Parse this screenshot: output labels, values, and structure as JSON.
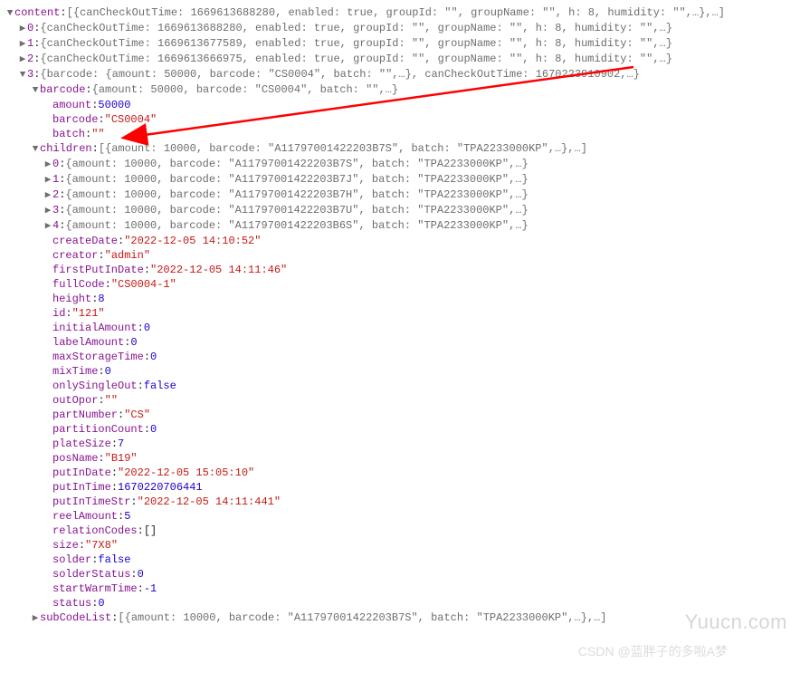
{
  "glyphs": {
    "down": "▼",
    "right": "▶"
  },
  "root": {
    "key": "content",
    "preview": "[{canCheckOutTime: 1669613688280, enabled: true, groupId: \"\", groupName: \"\", h: 8, humidity: \"\",…},…]"
  },
  "items": [
    {
      "idx": "0",
      "preview": "{canCheckOutTime: 1669613688280, enabled: true, groupId: \"\", groupName: \"\", h: 8, humidity: \"\",…}"
    },
    {
      "idx": "1",
      "preview": "{canCheckOutTime: 1669613677589, enabled: true, groupId: \"\", groupName: \"\", h: 8, humidity: \"\",…}"
    },
    {
      "idx": "2",
      "preview": "{canCheckOutTime: 1669613666975, enabled: true, groupId: \"\", groupName: \"\", h: 8, humidity: \"\",…}"
    },
    {
      "idx": "3",
      "preview": "{barcode: {amount: 50000, barcode: \"CS0004\", batch: \"\",…}, canCheckOutTime: 1670223910902,…}"
    }
  ],
  "barcode": {
    "key": "barcode",
    "preview": "{amount: 50000, barcode: \"CS0004\", batch: \"\",…}",
    "amount_key": "amount",
    "amount_val": "50000",
    "barcode_key": "barcode",
    "barcode_val": "\"CS0004\"",
    "batch_key": "batch",
    "batch_val": "\"\""
  },
  "children": {
    "key": "children",
    "preview": "[{amount: 10000, barcode: \"A11797001422203B7S\", batch: \"TPA2233000KP\",…},…]",
    "list": [
      {
        "idx": "0",
        "preview": "{amount: 10000, barcode: \"A11797001422203B7S\", batch: \"TPA2233000KP\",…}"
      },
      {
        "idx": "1",
        "preview": "{amount: 10000, barcode: \"A11797001422203B7J\", batch: \"TPA2233000KP\",…}"
      },
      {
        "idx": "2",
        "preview": "{amount: 10000, barcode: \"A11797001422203B7H\", batch: \"TPA2233000KP\",…}"
      },
      {
        "idx": "3",
        "preview": "{amount: 10000, barcode: \"A11797001422203B7U\", batch: \"TPA2233000KP\",…}"
      },
      {
        "idx": "4",
        "preview": "{amount: 10000, barcode: \"A11797001422203B6S\", batch: \"TPA2233000KP\",…}"
      }
    ]
  },
  "props": [
    {
      "key": "createDate",
      "val": "\"2022-12-05 14:10:52\"",
      "type": "str"
    },
    {
      "key": "creator",
      "val": "\"admin\"",
      "type": "str"
    },
    {
      "key": "firstPutInDate",
      "val": "\"2022-12-05 14:11:46\"",
      "type": "str"
    },
    {
      "key": "fullCode",
      "val": "\"CS0004-1\"",
      "type": "str"
    },
    {
      "key": "height",
      "val": "8",
      "type": "num"
    },
    {
      "key": "id",
      "val": "\"121\"",
      "type": "str"
    },
    {
      "key": "initialAmount",
      "val": "0",
      "type": "num"
    },
    {
      "key": "labelAmount",
      "val": "0",
      "type": "num"
    },
    {
      "key": "maxStorageTime",
      "val": "0",
      "type": "num"
    },
    {
      "key": "mixTime",
      "val": "0",
      "type": "num"
    },
    {
      "key": "onlySingleOut",
      "val": "false",
      "type": "bool"
    },
    {
      "key": "outOpor",
      "val": "\"\"",
      "type": "str"
    },
    {
      "key": "partNumber",
      "val": "\"CS\"",
      "type": "str"
    },
    {
      "key": "partitionCount",
      "val": "0",
      "type": "num"
    },
    {
      "key": "plateSize",
      "val": "7",
      "type": "num"
    },
    {
      "key": "posName",
      "val": "\"B19\"",
      "type": "str"
    },
    {
      "key": "putInDate",
      "val": "\"2022-12-05 15:05:10\"",
      "type": "str"
    },
    {
      "key": "putInTime",
      "val": "1670220706441",
      "type": "num"
    },
    {
      "key": "putInTimeStr",
      "val": "\"2022-12-05 14:11:441\"",
      "type": "str"
    },
    {
      "key": "reelAmount",
      "val": "5",
      "type": "num"
    },
    {
      "key": "relationCodes",
      "val": "[]",
      "type": "punc"
    },
    {
      "key": "size",
      "val": "\"7X8\"",
      "type": "str"
    },
    {
      "key": "solder",
      "val": "false",
      "type": "bool"
    },
    {
      "key": "solderStatus",
      "val": "0",
      "type": "num"
    },
    {
      "key": "startWarmTime",
      "val": "-1",
      "type": "num"
    },
    {
      "key": "status",
      "val": "0",
      "type": "num"
    }
  ],
  "subCodeList": {
    "key": "subCodeList",
    "preview": "[{amount: 10000, barcode: \"A11797001422203B7S\", batch: \"TPA2233000KP\",…},…]"
  },
  "watermark1": "Yuucn.com",
  "watermark2": "CSDN @蓝胖子的多啦A梦"
}
